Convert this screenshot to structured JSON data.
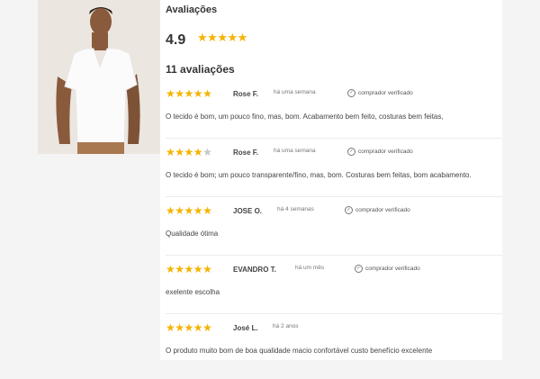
{
  "reviews_section": {
    "title": "Avaliações",
    "average_rating": "4.9",
    "average_stars": 5,
    "count_label": "11 avaliações"
  },
  "reviews": [
    {
      "stars": 5,
      "author": "Rose F.",
      "date": "há uma semana",
      "verified": "comprador verificado",
      "text": "O tecido é bom, um pouco fino, mas, bom. Acabamento bem feito, costuras bem feitas,"
    },
    {
      "stars": 4,
      "author": "Rose F.",
      "date": "há uma semana",
      "verified": "comprador verificado",
      "text": "O tecido é bom; um pouco transparente/fino, mas, bom. Costuras bem feitas, bom acabamento."
    },
    {
      "stars": 5,
      "author": "JOSE O.",
      "date": "há 4 semanas",
      "verified": "comprador verificado",
      "text": "Qualidade ótima"
    },
    {
      "stars": 5,
      "author": "EVANDRO T.",
      "date": "há um mês",
      "verified": "comprador verificado",
      "text": "exelente escolha"
    },
    {
      "stars": 5,
      "author": "José L.",
      "date": "há 2 anos",
      "verified": "",
      "text": "O produto muito bom de boa qualidade macio confortável custo benefício excelente"
    }
  ],
  "colors": {
    "star_filled": "#f5b301",
    "star_empty": "#c7c7c7"
  }
}
